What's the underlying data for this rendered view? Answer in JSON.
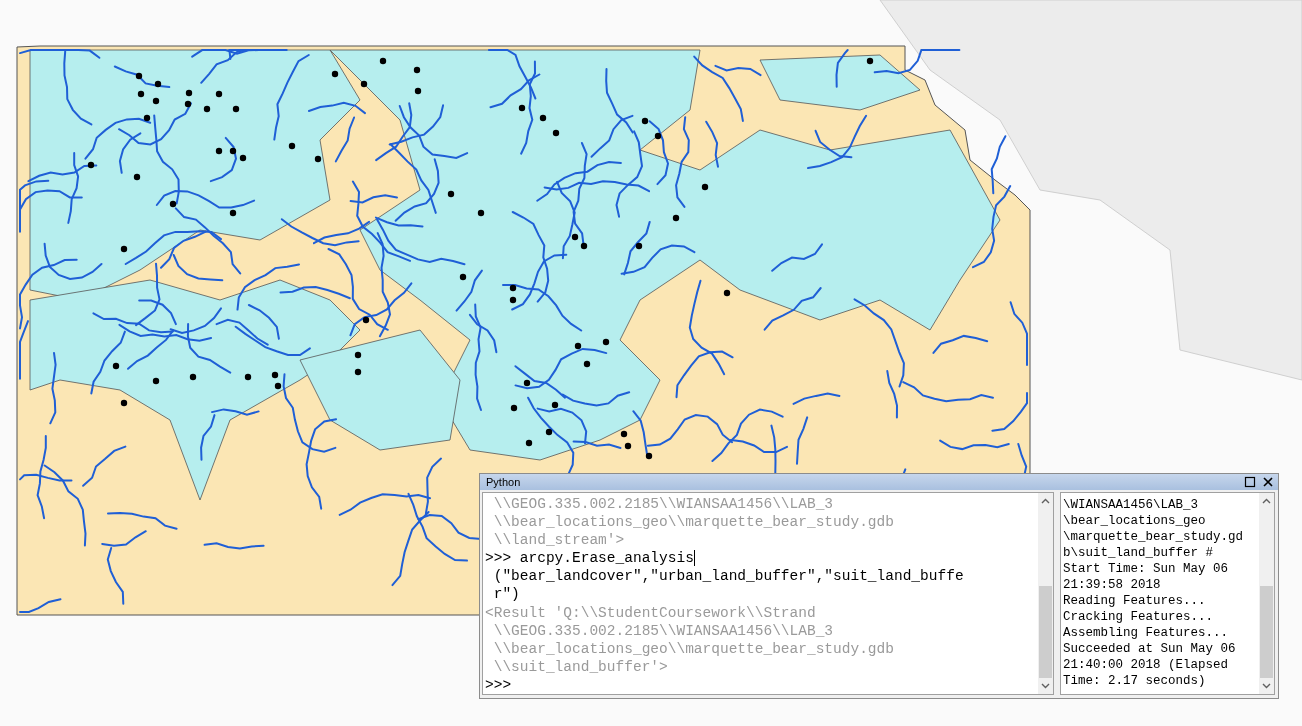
{
  "python_window": {
    "title": "Python",
    "console_lines": [
      {
        "kind": "output",
        "text": " \\\\GEOG.335.002.2185\\\\WIANSAA1456\\\\LAB_3"
      },
      {
        "kind": "output",
        "text": " \\\\bear_locations_geo\\\\marquette_bear_study.gdb"
      },
      {
        "kind": "output",
        "text": " \\\\land_stream'>"
      },
      {
        "kind": "input",
        "text": ">>> arcpy.Erase_analysis"
      },
      {
        "kind": "input",
        "text": " (\"bear_landcover\",\"urban_land_buffer\",\"suit_land_buffe"
      },
      {
        "kind": "input",
        "text": " r\")"
      },
      {
        "kind": "output",
        "text": "<Result 'Q:\\\\StudentCoursework\\\\Strand"
      },
      {
        "kind": "output",
        "text": " \\\\GEOG.335.002.2185\\\\WIANSAA1456\\\\LAB_3"
      },
      {
        "kind": "output",
        "text": " \\\\bear_locations_geo\\\\marquette_bear_study.gdb"
      },
      {
        "kind": "output",
        "text": " \\\\suit_land_buffer'>"
      },
      {
        "kind": "input",
        "text": ">>>"
      }
    ],
    "messages": [
      "\\WIANSAA1456\\LAB_3",
      "\\bear_locations_geo",
      "\\marquette_bear_study.gd",
      "b\\suit_land_buffer #",
      "Start Time: Sun May 06",
      "21:39:58 2018",
      "Reading Features...",
      "Cracking Features...",
      "Assembling Features...",
      "Succeeded at Sun May 06",
      "21:40:00 2018 (Elapsed",
      "Time: 2.17 seconds)"
    ]
  }
}
